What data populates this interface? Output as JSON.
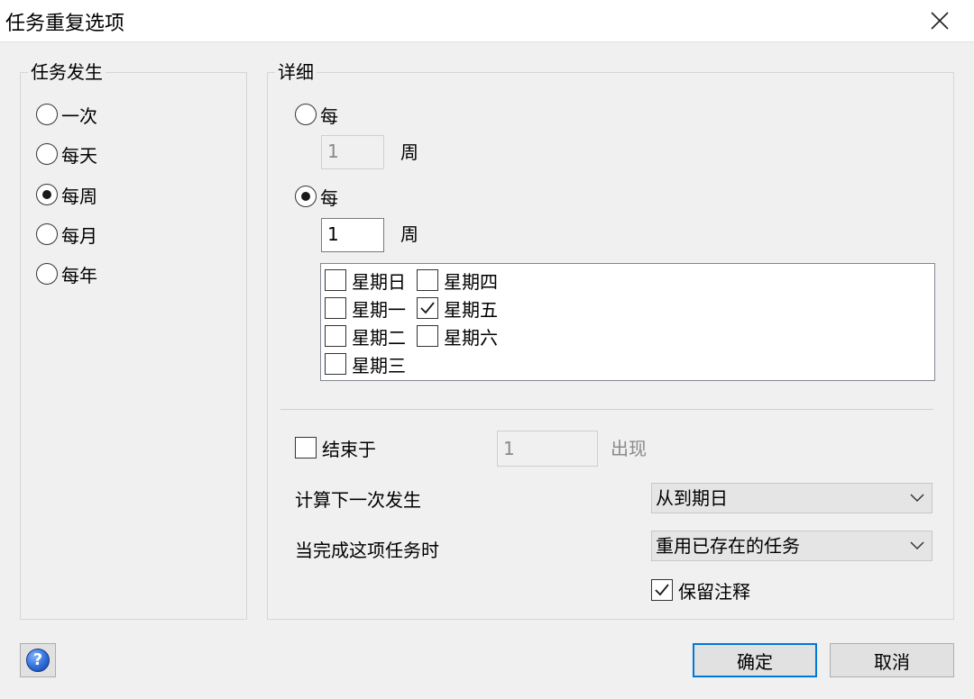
{
  "window": {
    "title": "任务重复选项",
    "close_icon": "close-icon"
  },
  "occurrence": {
    "legend": "任务发生",
    "options": [
      {
        "label": "一次",
        "selected": false
      },
      {
        "label": "每天",
        "selected": false
      },
      {
        "label": "每周",
        "selected": true
      },
      {
        "label": "每月",
        "selected": false
      },
      {
        "label": "每年",
        "selected": false
      }
    ]
  },
  "details": {
    "legend": "详细",
    "option_a": {
      "label": "每",
      "selected": false,
      "interval": "1",
      "unit": "周",
      "enabled": false
    },
    "option_b": {
      "label": "每",
      "selected": true,
      "interval": "1",
      "unit": "周",
      "enabled": true
    },
    "weekdays": [
      {
        "label": "星期日",
        "checked": false
      },
      {
        "label": "星期四",
        "checked": false
      },
      {
        "label": "星期一",
        "checked": false
      },
      {
        "label": "星期五",
        "checked": true
      },
      {
        "label": "星期二",
        "checked": false
      },
      {
        "label": "星期六",
        "checked": false
      },
      {
        "label": "星期三",
        "checked": false
      }
    ],
    "end_after": {
      "label": "结束于",
      "checked": false,
      "value": "1",
      "unit": "出现"
    },
    "calc_next": {
      "label": "计算下一次发生",
      "value": "从到期日"
    },
    "on_complete": {
      "label": "当完成这项任务时",
      "value": "重用已存在的任务"
    },
    "keep_notes": {
      "label": "保留注释",
      "checked": true
    }
  },
  "buttons": {
    "ok": "确定",
    "cancel": "取消",
    "help_icon": "help-icon",
    "help_glyph": "?"
  },
  "colors": {
    "accent": "#0078d7",
    "background": "#f0f0f0"
  }
}
